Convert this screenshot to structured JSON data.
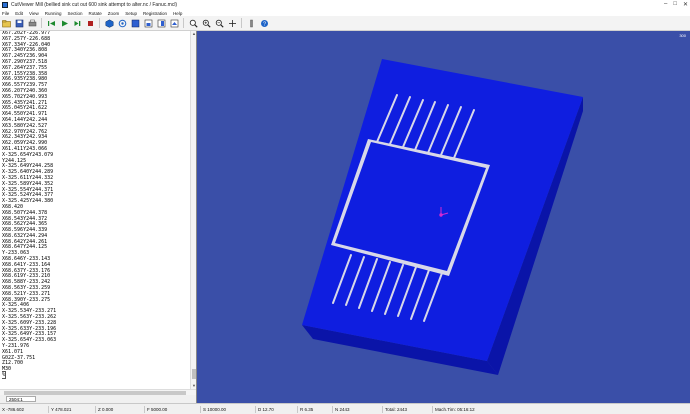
{
  "window": {
    "title": "CutViewer Mill (bellied sink cut out 600 sink attempt to alter.nc / Fanuc.mcl)",
    "controls": [
      "–",
      "□",
      "✕"
    ]
  },
  "menu": [
    "File",
    "Edit",
    "View",
    "Running",
    "Section",
    "Rotate",
    "Zoom",
    "Setup",
    "Registration",
    "Help"
  ],
  "toolbar": {
    "icons": [
      "folder-open-icon",
      "save-icon",
      "print-icon",
      "separator",
      "rewind-icon",
      "play-icon",
      "step-icon",
      "stop-icon",
      "separator",
      "cube-icon",
      "orbit-icon",
      "view-top-icon",
      "view-front-icon",
      "view-side-icon",
      "view-iso-icon",
      "separator",
      "zoom-fit-icon",
      "zoom-in-icon",
      "zoom-out-icon",
      "pan-icon",
      "separator",
      "tool-icon",
      "help-icon"
    ]
  },
  "code_lines": [
    "X67.202Y-226.977",
    "X67.257Y-226.688",
    "X67.334Y-226.040",
    "X67.340Y236.808",
    "X67.245Y236.904",
    "X67.290Y237.518",
    "X67.264Y237.755",
    "X67.155Y238.358",
    "X66.935Y238.980",
    "X66.557Y239.757",
    "X66.207Y240.360",
    "X65.702Y240.993",
    "X65.435Y241.271",
    "X65.045Y241.622",
    "X64.550Y241.971",
    "X64.144Y242.244",
    "X63.580Y242.527",
    "X62.970Y242.762",
    "X62.343Y242.934",
    "X62.059Y242.990",
    "X61.411Y243.066",
    "X-325.654Y243.079",
    "Y244.125",
    "X-325.649Y244.258",
    "X-325.640Y244.289",
    "X-325.611Y244.332",
    "X-325.589Y244.352",
    "X-325.554Y244.371",
    "X-325.524Y244.377",
    "X-325.425Y244.380",
    "X68.420",
    "X68.507Y244.378",
    "X68.543Y244.372",
    "X68.562Y244.365",
    "X68.596Y244.339",
    "X68.632Y244.294",
    "X68.642Y244.261",
    "X68.647Y244.125",
    "Y-233.063",
    "X68.646Y-233.143",
    "X68.641Y-233.164",
    "X68.637Y-233.176",
    "X68.619Y-233.210",
    "X68.588Y-233.242",
    "X68.563Y-233.259",
    "X68.521Y-233.271",
    "X68.390Y-233.275",
    "X-325.406",
    "X-325.534Y-233.271",
    "X-325.563Y-233.262",
    "X-325.609Y-233.228",
    "X-325.633Y-233.196",
    "X-325.649Y-233.157",
    "X-325.654Y-233.063",
    "Y-231.976",
    "X61.071",
    "G02Z-37.751",
    "Z12.700",
    "M30",
    "%"
  ],
  "current_line_index": 59,
  "line_number": "2504:1",
  "viewport": {
    "scale_label": "300",
    "background": "#3a4fa8",
    "stock_top": "#0f1ee0",
    "stock_side": "#0a14a8",
    "cut_color": "#d8d8e8"
  },
  "status": {
    "x": "X -786.602",
    "y": "Y 478.021",
    "z": "Z 0.000",
    "f": "F 5000.00",
    "s": "S 10000.00",
    "d": "D 12.70",
    "r": "R 6.35",
    "n": "N 2443",
    "total": "Total: 2443",
    "mach_tim": "Mach.Tim: 05:16:12"
  }
}
